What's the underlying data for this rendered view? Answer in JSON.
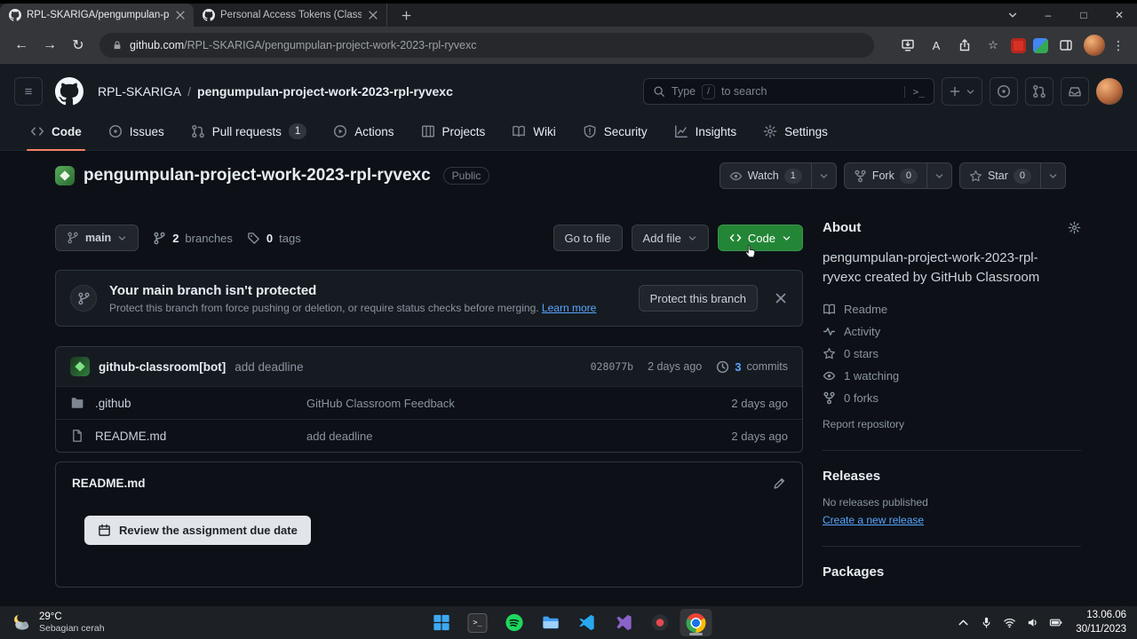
{
  "browser": {
    "tabs": [
      {
        "title": "RPL-SKARIGA/pengumpulan-pr",
        "active": true
      },
      {
        "title": "Personal Access Tokens (Classic)",
        "active": false
      }
    ],
    "url_domain": "github.com",
    "url_path": "/RPL-SKARIGA/pengumpulan-project-work-2023-rpl-ryvexc"
  },
  "icons": {
    "hamburger": "≡",
    "kebab": "⋮",
    "minimize": "–",
    "maximize": "□",
    "close": "✕",
    "back": "←",
    "forward": "→",
    "reload": "↻",
    "star": "☆",
    "translate": "A",
    "prompt": ">_"
  },
  "gh_header": {
    "org": "RPL-SKARIGA",
    "separator": "/",
    "repo": "pengumpulan-project-work-2023-rpl-ryvexc",
    "search": {
      "prefix": "Type",
      "key": "/",
      "suffix": "to search"
    }
  },
  "nav": {
    "items": [
      {
        "icon": "code",
        "label": "Code"
      },
      {
        "icon": "issue-opened",
        "label": "Issues"
      },
      {
        "icon": "git-pull-request",
        "label": "Pull requests",
        "badge": "1"
      },
      {
        "icon": "play",
        "label": "Actions"
      },
      {
        "icon": "table",
        "label": "Projects"
      },
      {
        "icon": "book",
        "label": "Wiki"
      },
      {
        "icon": "shield",
        "label": "Security"
      },
      {
        "icon": "graph",
        "label": "Insights"
      },
      {
        "icon": "gear",
        "label": "Settings"
      }
    ]
  },
  "repo": {
    "title": "pengumpulan-project-work-2023-rpl-ryvexc",
    "visibility": "Public",
    "watch": {
      "label": "Watch",
      "count": "1"
    },
    "fork": {
      "label": "Fork",
      "count": "0"
    },
    "star": {
      "label": "Star",
      "count": "0"
    }
  },
  "toolbar": {
    "branch": "main",
    "branches": {
      "count": "2",
      "label": "branches"
    },
    "tags": {
      "count": "0",
      "label": "tags"
    },
    "go_to_file": "Go to file",
    "add_file": "Add file",
    "code": "Code"
  },
  "banner": {
    "title": "Your main branch isn't protected",
    "description": "Protect this branch from force pushing or deletion, or require status checks before merging.",
    "learn_more": "Learn more",
    "action": "Protect this branch"
  },
  "commit": {
    "author": "github-classroom[bot]",
    "message": "add deadline",
    "hash": "028077b",
    "date": "2 days ago",
    "count": "3",
    "count_label": "commits"
  },
  "files": [
    {
      "icon": "folder",
      "name": ".github",
      "message": "GitHub Classroom Feedback",
      "date": "2 days ago"
    },
    {
      "icon": "file",
      "name": "README.md",
      "message": "add deadline",
      "date": "2 days ago"
    }
  ],
  "readme": {
    "filename": "README.md",
    "due_button": "Review the assignment due date"
  },
  "sidebar": {
    "about": {
      "title": "About",
      "description": "pengumpulan-project-work-2023-rpl-ryvexc created by GitHub Classroom",
      "links": [
        {
          "icon": "book",
          "label": "Readme"
        },
        {
          "icon": "pulse",
          "label": "Activity"
        },
        {
          "icon": "star",
          "label": "0 stars"
        },
        {
          "icon": "eye",
          "label": "1 watching"
        },
        {
          "icon": "repo-forked",
          "label": "0 forks"
        }
      ],
      "report": "Report repository"
    },
    "releases": {
      "title": "Releases",
      "empty": "No releases published",
      "create": "Create a new release"
    },
    "packages": {
      "title": "Packages"
    }
  },
  "taskbar": {
    "weather": {
      "temp": "29°C",
      "condition": "Sebagian cerah"
    },
    "apps": [
      "start",
      "terminal",
      "spotify",
      "explorer",
      "vscode",
      "visual-studio",
      "media",
      "chrome"
    ],
    "clock": {
      "time": "13.06.06",
      "date": "30/11/2023"
    }
  },
  "colors": {
    "accent_green": "#238636",
    "link_blue": "#58a6ff",
    "nav_active": "#f78166"
  }
}
